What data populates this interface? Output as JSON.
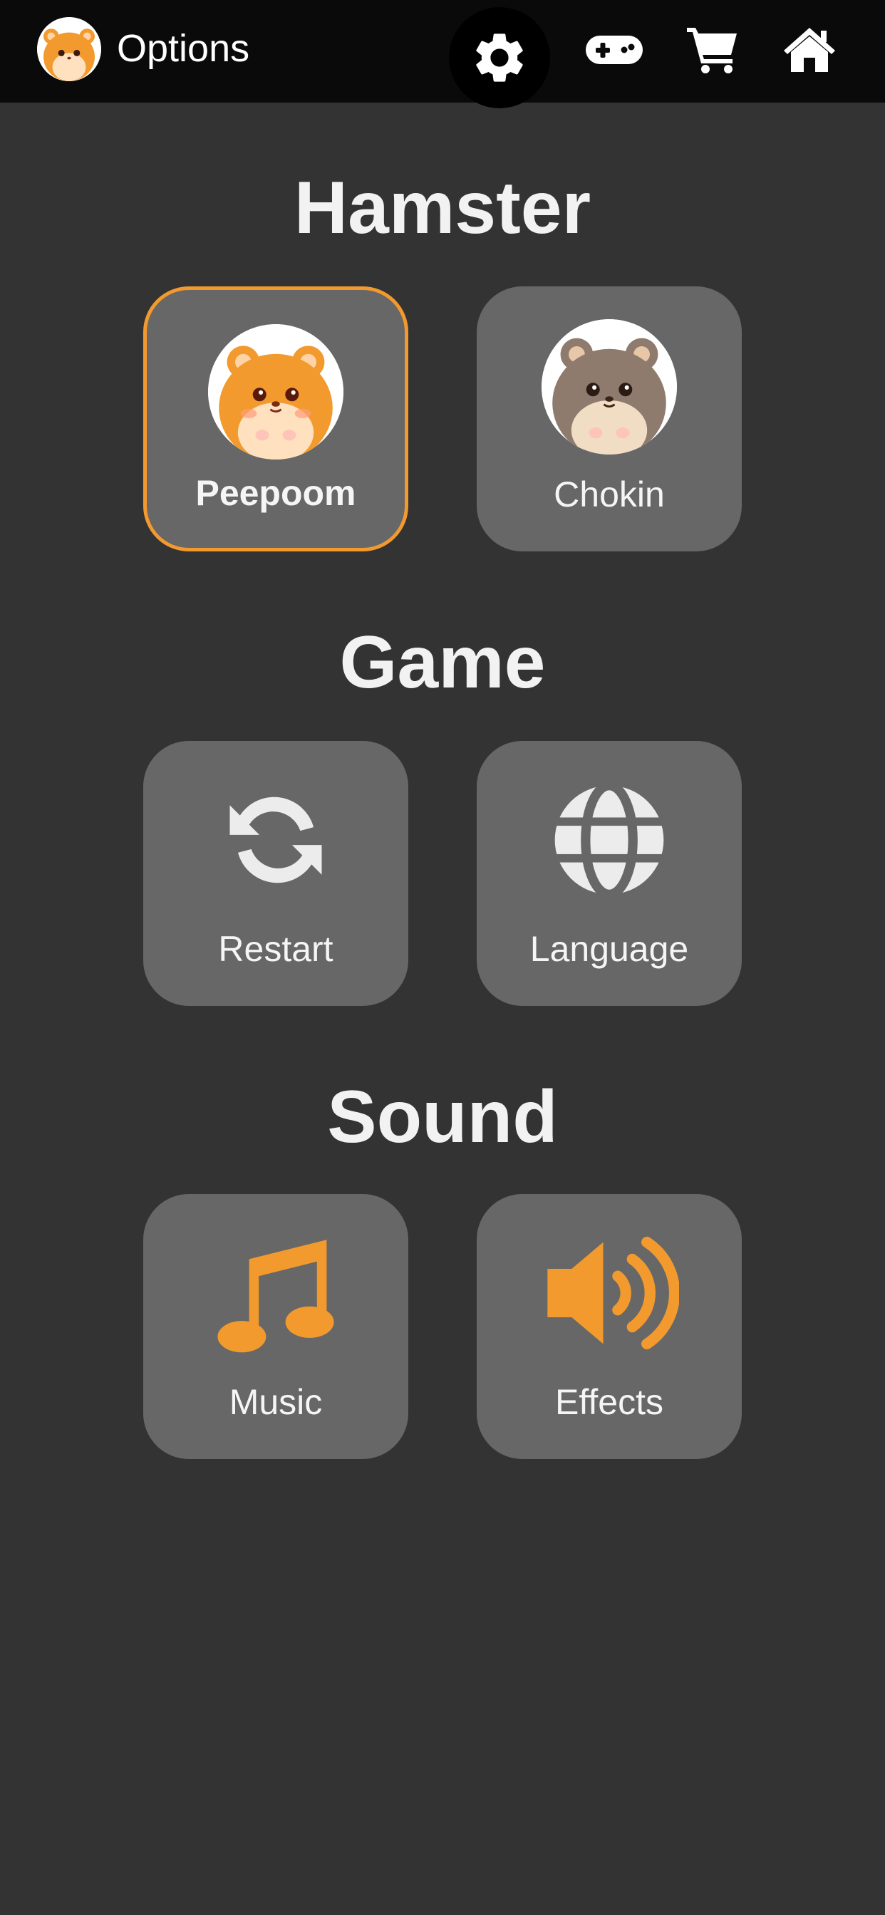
{
  "header": {
    "title": "Options",
    "avatar_icon": "hamster-face-icon",
    "nav": [
      {
        "icon": "gear-icon",
        "active": true
      },
      {
        "icon": "gamepad-icon"
      },
      {
        "icon": "cart-icon"
      },
      {
        "icon": "home-icon"
      }
    ]
  },
  "sections": {
    "hamster": {
      "title": "Hamster",
      "options": [
        {
          "label": "Peepoom",
          "selected": true,
          "color": "#f29a2e"
        },
        {
          "label": "Chokin",
          "selected": false,
          "color": "#8f7b6e"
        }
      ]
    },
    "game": {
      "title": "Game",
      "options": [
        {
          "label": "Restart",
          "icon": "restart-icon"
        },
        {
          "label": "Language",
          "icon": "globe-icon"
        }
      ]
    },
    "sound": {
      "title": "Sound",
      "options": [
        {
          "label": "Music",
          "icon": "music-note-icon"
        },
        {
          "label": "Effects",
          "icon": "speaker-icon"
        }
      ]
    }
  },
  "colors": {
    "background": "#333333",
    "topbar": "#0a0a0a",
    "card": "#676767",
    "accent": "#f29a2e",
    "icon_light": "#ececec"
  }
}
